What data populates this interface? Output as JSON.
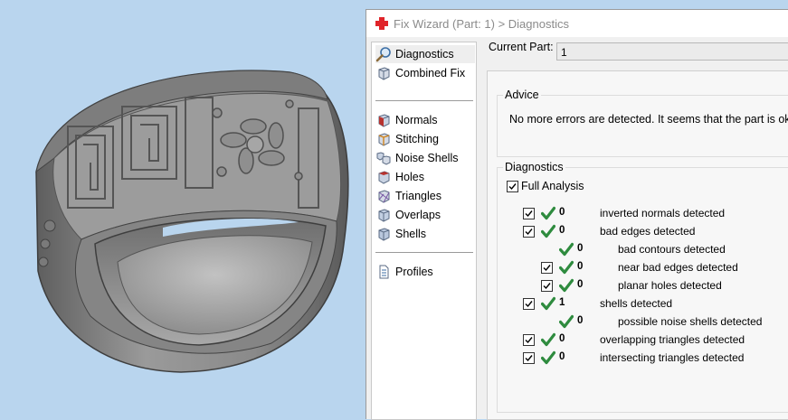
{
  "window": {
    "title": "Fix Wizard (Part: 1) > Diagnostics"
  },
  "nav": {
    "items": [
      {
        "label": "Diagnostics",
        "icon": "magnifier-icon"
      },
      {
        "label": "Combined Fix",
        "icon": "cube-icon"
      },
      {
        "label": "Normals",
        "icon": "normals-cube-icon"
      },
      {
        "label": "Stitching",
        "icon": "stitching-cube-icon"
      },
      {
        "label": "Noise Shells",
        "icon": "noise-shells-icon"
      },
      {
        "label": "Holes",
        "icon": "holes-cube-icon"
      },
      {
        "label": "Triangles",
        "icon": "triangles-cube-icon"
      },
      {
        "label": "Overlaps",
        "icon": "overlaps-cube-icon"
      },
      {
        "label": "Shells",
        "icon": "shells-cube-icon"
      },
      {
        "label": "Profiles",
        "icon": "document-icon"
      }
    ],
    "selected": "Diagnostics"
  },
  "current_part": {
    "label": "Current Part:",
    "value": "1"
  },
  "advice": {
    "title": "Advice",
    "text": "No more errors are detected. It seems that the part is ok."
  },
  "diagnostics": {
    "title": "Diagnostics",
    "full_analysis_label": "Full Analysis",
    "full_analysis_checked": true,
    "rows": [
      {
        "count": "0",
        "label": "inverted normals detected",
        "checkbox": true
      },
      {
        "count": "0",
        "label": "bad edges detected",
        "checkbox": true
      },
      {
        "count": "0",
        "label": "bad contours detected",
        "checkbox": false
      },
      {
        "count": "0",
        "label": "near bad edges detected",
        "checkbox": true
      },
      {
        "count": "0",
        "label": "planar holes detected",
        "checkbox": true
      },
      {
        "count": "1",
        "label": "shells detected",
        "checkbox": true
      },
      {
        "count": "0",
        "label": "possible noise shells detected",
        "checkbox": false
      },
      {
        "count": "0",
        "label": "overlapping triangles detected",
        "checkbox": true
      },
      {
        "count": "0",
        "label": "intersecting triangles detected",
        "checkbox": true
      }
    ]
  },
  "colors": {
    "viewport_bg": "#b9d5ee",
    "check_green": "#2e8b3e",
    "title_icon_red": "#e0242a"
  }
}
